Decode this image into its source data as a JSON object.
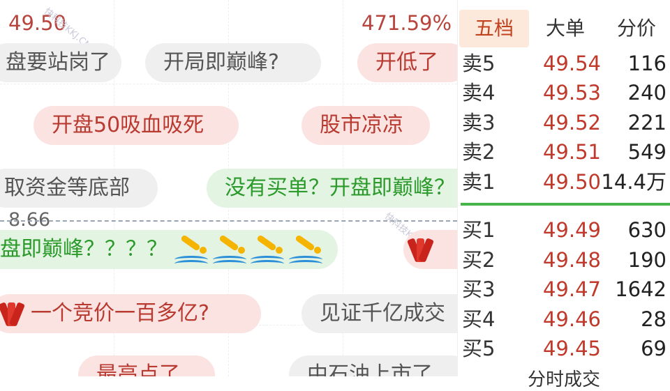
{
  "chart": {
    "price_top_left": "49.50",
    "pct_top_right": "471.59%",
    "mid_price": "8.66"
  },
  "watermark": {
    "text1": "快科技KKJ.CN",
    "text2": "快科技KKJ.CN"
  },
  "comments": [
    {
      "text": "盘要站岗了",
      "style": "gray"
    },
    {
      "text": "开局即巅峰?",
      "style": "gray"
    },
    {
      "text": "开低了",
      "style": "red"
    },
    {
      "text": "开盘50吸血吸死",
      "style": "red"
    },
    {
      "text": "股市凉凉",
      "style": "red"
    },
    {
      "text": "取资金等底部",
      "style": "gray"
    },
    {
      "text": "没有买单？开盘即巅峰？",
      "style": "green"
    },
    {
      "text": "盘即巅峰？？？？",
      "style": "green"
    },
    {
      "text": "一个竞价一百多亿?",
      "style": "red"
    },
    {
      "text": "见证千亿成交",
      "style": "gray"
    },
    {
      "text": "最高点了",
      "style": "red"
    },
    {
      "text": "中石油上市了",
      "style": "gray"
    }
  ],
  "orderbook": {
    "tabs": [
      "五档",
      "大单",
      "分价"
    ],
    "active_tab": "五档",
    "sell": [
      {
        "label": "卖5",
        "price": "49.54",
        "volume": "116"
      },
      {
        "label": "卖4",
        "price": "49.53",
        "volume": "240"
      },
      {
        "label": "卖3",
        "price": "49.52",
        "volume": "221"
      },
      {
        "label": "卖2",
        "price": "49.51",
        "volume": "549"
      },
      {
        "label": "卖1",
        "price": "49.50",
        "volume": "14.4万"
      }
    ],
    "buy": [
      {
        "label": "买1",
        "price": "49.49",
        "volume": "630"
      },
      {
        "label": "买2",
        "price": "49.48",
        "volume": "190"
      },
      {
        "label": "买3",
        "price": "49.47",
        "volume": "1642"
      },
      {
        "label": "买4",
        "price": "49.46",
        "volume": "28"
      },
      {
        "label": "买5",
        "price": "49.45",
        "volume": "69"
      }
    ],
    "bottom_label": "分时成交"
  },
  "colors": {
    "price_red": "#c0392b",
    "divider_green": "#47b64a",
    "active_tab_bg": "#fde9dc"
  }
}
